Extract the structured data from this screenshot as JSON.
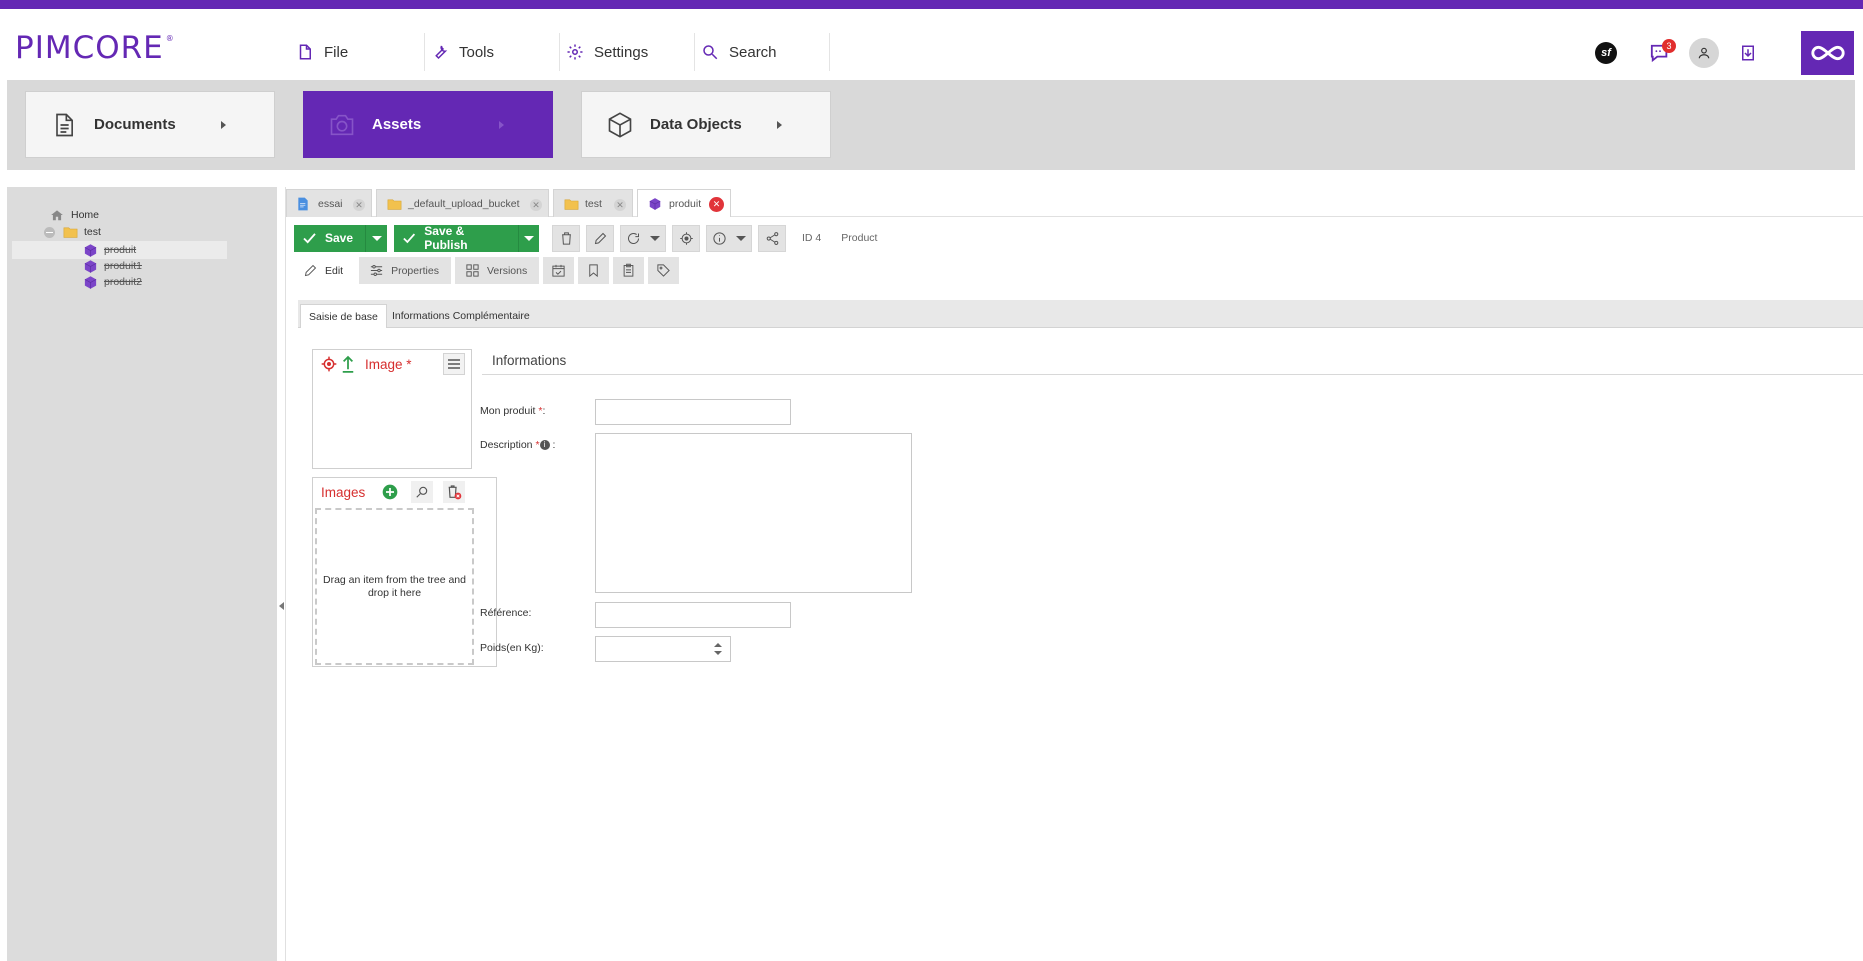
{
  "app": {
    "logo_text": "PIMCORE",
    "logo_mark": "®"
  },
  "menu": [
    {
      "label": "File",
      "icon": "file-icon"
    },
    {
      "label": "Tools",
      "icon": "wrench-icon"
    },
    {
      "label": "Settings",
      "icon": "gear-icon"
    },
    {
      "label": "Search",
      "icon": "search-icon"
    }
  ],
  "topright": {
    "symfony_label": "sf",
    "notifications_count": "3"
  },
  "mainnav": {
    "documents": "Documents",
    "assets": "Assets",
    "data_objects": "Data Objects"
  },
  "tree": {
    "home": "Home",
    "folder": "test",
    "items": [
      "produit",
      "produit1",
      "produit2"
    ]
  },
  "tabs": [
    {
      "label": "essai",
      "icon": "document-icon"
    },
    {
      "label": "_default_upload_bucket",
      "icon": "folder-icon"
    },
    {
      "label": "test",
      "icon": "folder-icon"
    },
    {
      "label": "produit",
      "icon": "cube-icon"
    }
  ],
  "toolbar": {
    "save_label": "Save",
    "save_publish_label": "Save & Publish",
    "id_label": "ID 4",
    "class_label": "Product"
  },
  "subtabs": {
    "edit": "Edit",
    "properties": "Properties",
    "versions": "Versions"
  },
  "formtabs": {
    "basic": "Saisie de base",
    "extra": "Informations Complémentaire"
  },
  "image_panel": {
    "title": "Image *"
  },
  "images_panel": {
    "title": "Images",
    "drop_text": "Drag an item from the tree and drop it here"
  },
  "informations": {
    "title": "Informations",
    "fields": {
      "mon_produit": "Mon produit",
      "description": "Description",
      "reference": "Référence:",
      "poids": "Poids(en Kg):"
    }
  },
  "colors": {
    "brand": "#6428b4",
    "success": "#2e9e4b",
    "required": "#d62f2f"
  }
}
